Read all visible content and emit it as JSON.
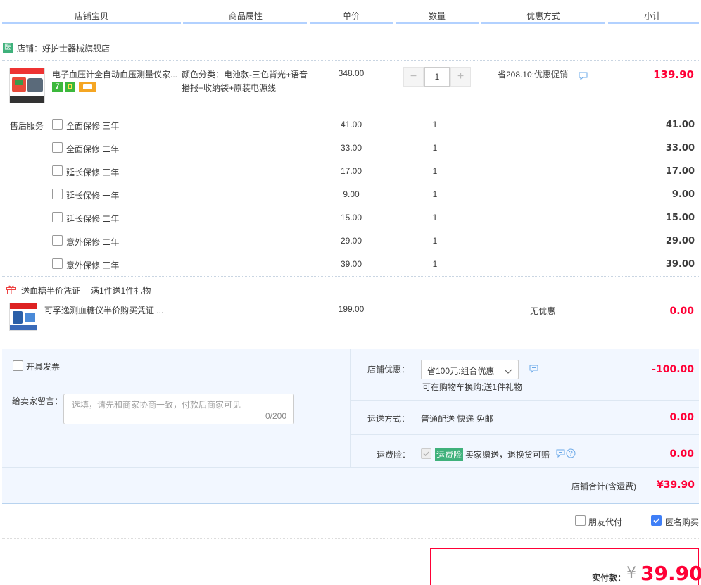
{
  "header": {
    "col_item": "店铺宝贝",
    "col_attr": "商品属性",
    "col_price": "单价",
    "col_qty": "数量",
    "col_discount": "优惠方式",
    "col_subtotal": "小计"
  },
  "shop": {
    "badge": "医",
    "name": "店铺：好护士器械旗舰店"
  },
  "product": {
    "title": "电子血压计全自动血压测量仪家...",
    "attr": "颜色分类：电池款-三色背光+语音播报+收纳袋+原装电源线",
    "price": "348.00",
    "qty": "1",
    "discount": "省208.10:优惠促销",
    "subtotal": "139.90",
    "minus": "−",
    "plus": "+"
  },
  "service": {
    "label": "售后服务",
    "items": [
      {
        "name": "全面保修 三年",
        "price": "41.00",
        "qty": "1",
        "subtotal": "41.00"
      },
      {
        "name": "全面保修 二年",
        "price": "33.00",
        "qty": "1",
        "subtotal": "33.00"
      },
      {
        "name": "延长保修 三年",
        "price": "17.00",
        "qty": "1",
        "subtotal": "17.00"
      },
      {
        "name": "延长保修 一年",
        "price": "9.00",
        "qty": "1",
        "subtotal": "9.00"
      },
      {
        "name": "延长保修 二年",
        "price": "15.00",
        "qty": "1",
        "subtotal": "15.00"
      },
      {
        "name": "意外保修 二年",
        "price": "29.00",
        "qty": "1",
        "subtotal": "29.00"
      },
      {
        "name": "意外保修 三年",
        "price": "39.00",
        "qty": "1",
        "subtotal": "39.00"
      }
    ]
  },
  "gift": {
    "title": "送血糖半价凭证",
    "rule": "满1件送1件礼物",
    "item_title": "可孚逸测血糖仪半价购买凭证 ...",
    "price": "199.00",
    "discount": "无优惠",
    "subtotal": "0.00"
  },
  "invoice": {
    "label": "开具发票"
  },
  "message": {
    "label": "给卖家留言：",
    "placeholder": "选填，请先和商家协商一致，付款后商家可见",
    "counter": "0/200"
  },
  "shop_discount": {
    "label": "店铺优惠：",
    "selected": "省100元:组合优惠",
    "note": "可在购物车换购;送1件礼物",
    "amount": "-100.00"
  },
  "shipping": {
    "label": "运送方式：",
    "method": "普通配送 快递 免邮",
    "amount": "0.00"
  },
  "insurance": {
    "label": "运费险：",
    "badge": "运费险",
    "desc": "卖家赠送，退换货可赔",
    "amount": "0.00"
  },
  "shop_total": {
    "label": "店铺合计(含运费)",
    "amount": "¥39.90"
  },
  "options": {
    "friend_pay": "朋友代付",
    "anonymous": "匿名购买"
  },
  "payment": {
    "label": "实付款：",
    "currency": "¥",
    "amount": "39.90"
  },
  "colors": {
    "accent_red": "#ff0036",
    "header_line": "#b2d1ff",
    "panel_bg": "#f2f7ff",
    "checkbox_blue": "#3f7ff7",
    "badge_green": "#3fb17b"
  }
}
